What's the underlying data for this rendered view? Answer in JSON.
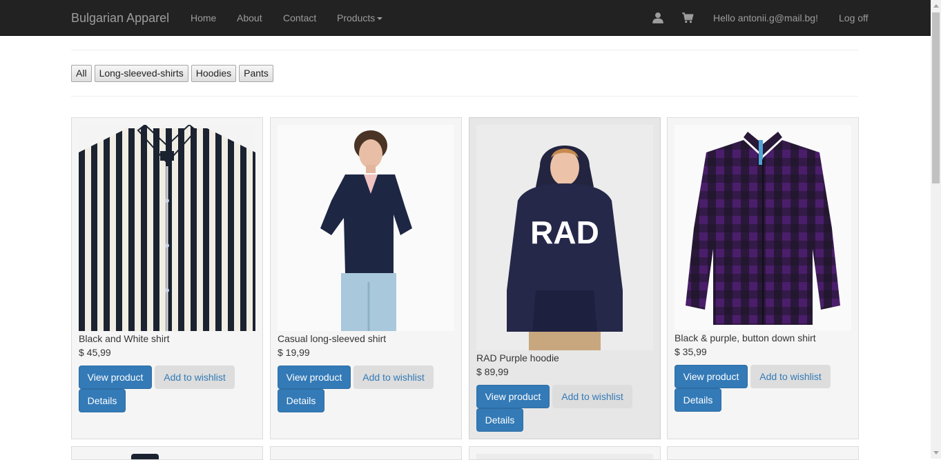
{
  "navbar": {
    "brand": "Bulgarian Apparel",
    "links": [
      "Home",
      "About",
      "Contact",
      "Products"
    ],
    "greeting": "Hello antonii.g@mail.bg!",
    "logoff": "Log off",
    "icons": [
      "user-icon",
      "shopping-cart-icon"
    ]
  },
  "filters": [
    "All",
    "Long-sleeved-shirts",
    "Hoodies",
    "Pants"
  ],
  "products": [
    {
      "name": "Black and White shirt",
      "price": "$ 45,99",
      "view": "View product",
      "wishlist": "Add to wishlist",
      "details": "Details"
    },
    {
      "name": "Casual long-sleeved shirt",
      "price": "$ 19,99",
      "view": "View product",
      "wishlist": "Add to wishlist",
      "details": "Details"
    },
    {
      "name": "RAD Purple hoodie",
      "price": "$ 89,99",
      "view": "View product",
      "wishlist": "Add to wishlist",
      "details": "Details",
      "print": "RAD"
    },
    {
      "name": "Black & purple, button down shirt",
      "price": "$ 35,99",
      "view": "View product",
      "wishlist": "Add to wishlist",
      "details": "Details"
    }
  ],
  "colors": {
    "navbar": "#222222",
    "nav_text": "#9d9d9d",
    "primary": "#337ab7",
    "wishlist_bg": "#dddddd",
    "card_bg": "#f5f5f5"
  }
}
